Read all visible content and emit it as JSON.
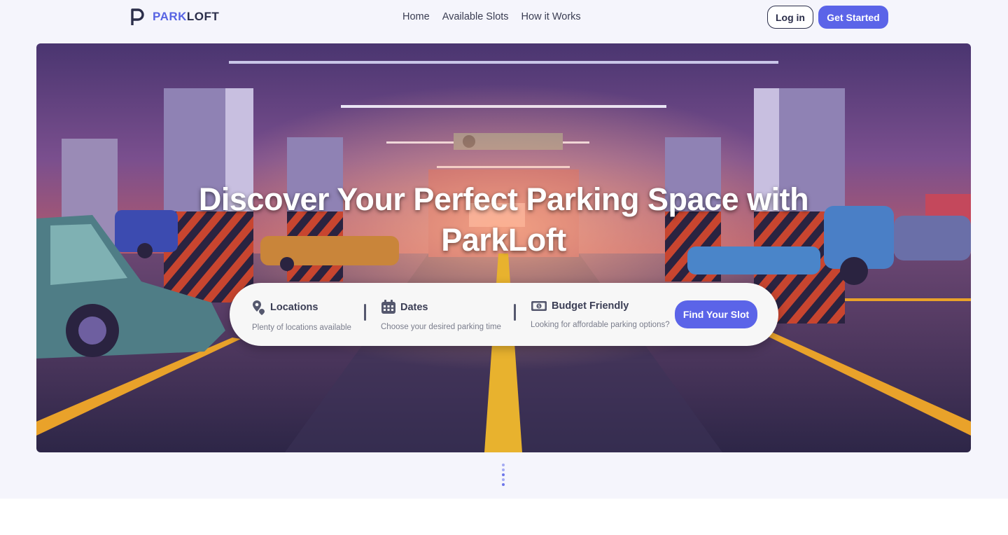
{
  "brand": {
    "name_part1": "PARK",
    "name_part2": "LOFT",
    "accent": "#5763e3"
  },
  "nav": {
    "home": "Home",
    "slots": "Available Slots",
    "how": "How it Works"
  },
  "auth": {
    "login": "Log in",
    "get_started": "Get Started"
  },
  "hero": {
    "title_line1": "Discover Your Perfect Parking Space with",
    "title_line2": "ParkLoft"
  },
  "search": {
    "locations": {
      "title": "Locations",
      "subtitle": "Plenty of locations available",
      "icon": "map-pin-icon"
    },
    "dates": {
      "title": "Dates",
      "subtitle": "Choose your desired parking time",
      "icon": "calendar-icon"
    },
    "budget": {
      "title": "Budget Friendly",
      "subtitle": "Looking for affordable parking options?",
      "icon": "money-icon"
    },
    "cta": "Find Your Slot"
  },
  "colors": {
    "primary": "#5b64e8",
    "dark": "#2b2e4a"
  }
}
